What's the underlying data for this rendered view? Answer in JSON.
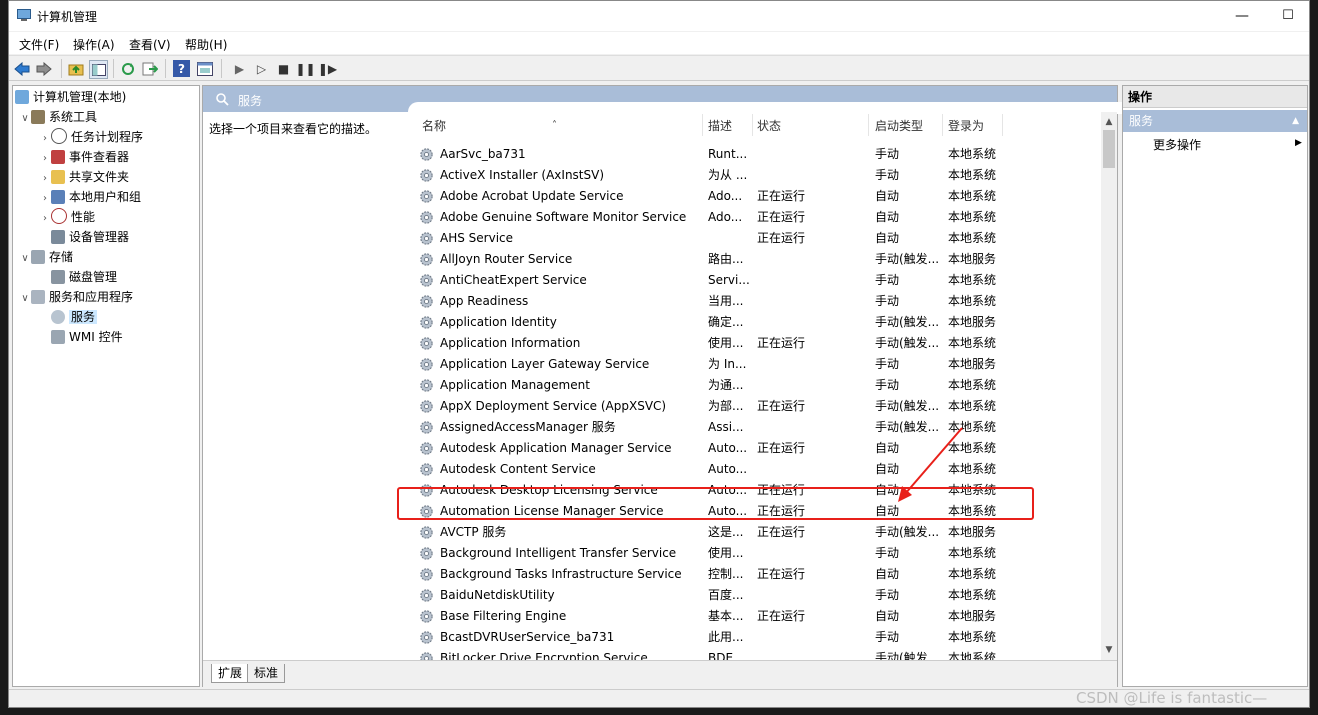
{
  "window": {
    "title": "计算机管理"
  },
  "menu": [
    "文件(F)",
    "操作(A)",
    "查看(V)",
    "帮助(H)"
  ],
  "tree": {
    "root": "计算机管理(本地)",
    "system_tools": "系统工具",
    "task_scheduler": "任务计划程序",
    "event_viewer": "事件查看器",
    "shared_folders": "共享文件夹",
    "local_users": "本地用户和组",
    "performance": "性能",
    "device_manager": "设备管理器",
    "storage": "存储",
    "disk_management": "磁盘管理",
    "services_apps": "服务和应用程序",
    "services": "服务",
    "wmi": "WMI 控件"
  },
  "panel": {
    "title": "服务",
    "description": "选择一个项目来查看它的描述。",
    "columns": {
      "name": "名称",
      "desc": "描述",
      "status": "状态",
      "startup": "启动类型",
      "logon": "登录为"
    },
    "tabs": [
      "扩展",
      "标准"
    ]
  },
  "services": [
    {
      "name": "AarSvc_ba731",
      "desc": "Runt...",
      "status": "",
      "startup": "手动",
      "logon": "本地系统"
    },
    {
      "name": "ActiveX Installer (AxInstSV)",
      "desc": "为从 ...",
      "status": "",
      "startup": "手动",
      "logon": "本地系统"
    },
    {
      "name": "Adobe Acrobat Update Service",
      "desc": "Ado...",
      "status": "正在运行",
      "startup": "自动",
      "logon": "本地系统"
    },
    {
      "name": "Adobe Genuine Software Monitor Service",
      "desc": "Ado...",
      "status": "正在运行",
      "startup": "自动",
      "logon": "本地系统"
    },
    {
      "name": "AHS Service",
      "desc": "",
      "status": "正在运行",
      "startup": "自动",
      "logon": "本地系统"
    },
    {
      "name": "AllJoyn Router Service",
      "desc": "路由...",
      "status": "",
      "startup": "手动(触发...",
      "logon": "本地服务"
    },
    {
      "name": "AntiCheatExpert Service",
      "desc": "Servi...",
      "status": "",
      "startup": "手动",
      "logon": "本地系统"
    },
    {
      "name": "App Readiness",
      "desc": "当用...",
      "status": "",
      "startup": "手动",
      "logon": "本地系统"
    },
    {
      "name": "Application Identity",
      "desc": "确定...",
      "status": "",
      "startup": "手动(触发...",
      "logon": "本地服务"
    },
    {
      "name": "Application Information",
      "desc": "使用...",
      "status": "正在运行",
      "startup": "手动(触发...",
      "logon": "本地系统"
    },
    {
      "name": "Application Layer Gateway Service",
      "desc": "为 In...",
      "status": "",
      "startup": "手动",
      "logon": "本地服务"
    },
    {
      "name": "Application Management",
      "desc": "为通...",
      "status": "",
      "startup": "手动",
      "logon": "本地系统"
    },
    {
      "name": "AppX Deployment Service (AppXSVC)",
      "desc": "为部...",
      "status": "正在运行",
      "startup": "手动(触发...",
      "logon": "本地系统"
    },
    {
      "name": "AssignedAccessManager 服务",
      "desc": "Assi...",
      "status": "",
      "startup": "手动(触发...",
      "logon": "本地系统"
    },
    {
      "name": "Autodesk Application Manager Service",
      "desc": "Auto...",
      "status": "正在运行",
      "startup": "自动",
      "logon": "本地系统"
    },
    {
      "name": "Autodesk Content Service",
      "desc": "Auto...",
      "status": "",
      "startup": "自动",
      "logon": "本地系统"
    },
    {
      "name": "Autodesk Desktop Licensing Service",
      "desc": "Auto...",
      "status": "正在运行",
      "startup": "自动",
      "logon": "本地系统"
    },
    {
      "name": "Automation License Manager Service",
      "desc": "Auto...",
      "status": "正在运行",
      "startup": "自动",
      "logon": "本地系统"
    },
    {
      "name": "AVCTP 服务",
      "desc": "这是...",
      "status": "正在运行",
      "startup": "手动(触发...",
      "logon": "本地服务"
    },
    {
      "name": "Background Intelligent Transfer Service",
      "desc": "使用...",
      "status": "",
      "startup": "手动",
      "logon": "本地系统"
    },
    {
      "name": "Background Tasks Infrastructure Service",
      "desc": "控制...",
      "status": "正在运行",
      "startup": "自动",
      "logon": "本地系统"
    },
    {
      "name": "BaiduNetdiskUtility",
      "desc": "百度...",
      "status": "",
      "startup": "手动",
      "logon": "本地系统"
    },
    {
      "name": "Base Filtering Engine",
      "desc": "基本...",
      "status": "正在运行",
      "startup": "自动",
      "logon": "本地服务"
    },
    {
      "name": "BcastDVRUserService_ba731",
      "desc": "此用...",
      "status": "",
      "startup": "手动",
      "logon": "本地系统"
    },
    {
      "name": "BitLocker Drive Encryption Service",
      "desc": "BDE...",
      "status": "",
      "startup": "手动(触发...",
      "logon": "本地系统"
    }
  ],
  "actions": {
    "header": "操作",
    "section": "服务",
    "more": "更多操作"
  },
  "watermark": "CSDN @Life is fantastic—",
  "colors": {
    "panel_header": "#a9bdd8",
    "highlight_box": "#e8201a",
    "selection": "#cce8ff"
  }
}
